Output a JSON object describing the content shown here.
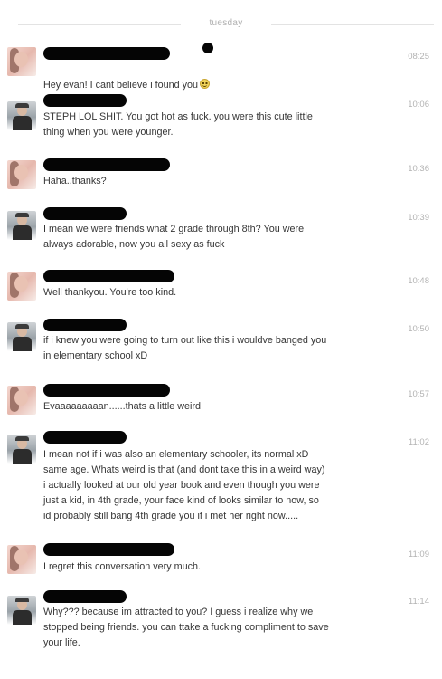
{
  "day_label": "tuesday",
  "messages": [
    {
      "sender": "her",
      "time": "08:25",
      "text": "Hey evan! I cant believe i found you",
      "emoji": "smiley-icon"
    },
    {
      "sender": "him",
      "time": "10:06",
      "text": "STEPH LOL SHIT. You got hot as fuck. you were this cute little\nthing when you were younger."
    },
    {
      "sender": "her",
      "time": "10:36",
      "text": "Haha..thanks?"
    },
    {
      "sender": "him",
      "time": "10:39",
      "text": "I mean we were friends what 2 grade through 8th? You were\nalways adorable, now you all sexy as fuck"
    },
    {
      "sender": "her",
      "time": "10:48",
      "text": "Well thankyou. You're too kind."
    },
    {
      "sender": "him",
      "time": "10:50",
      "text": "if i knew you were going to turn out like this i wouldve banged you\nin elementary school xD"
    },
    {
      "sender": "her",
      "time": "10:57",
      "text": "Evaaaaaaaaan......thats a little weird."
    },
    {
      "sender": "him",
      "time": "11:02",
      "text": "I mean not if i was also an elementary schooler, its normal xD\nsame age. Whats weird is that (and dont take this in a weird way)\ni actually looked at our old year book and even though you were\njust a kid, in 4th grade, your face kind of looks similar to now, so\nid probably still bang 4th grade you if i met her right now....."
    },
    {
      "sender": "her",
      "time": "11:09",
      "text": "I regret this conversation very much."
    },
    {
      "sender": "him",
      "time": "11:14",
      "text": "Why??? because im attracted to you? I guess i realize why we\nstopped being friends. you can ttake a fucking compliment to save\nyour life."
    }
  ]
}
